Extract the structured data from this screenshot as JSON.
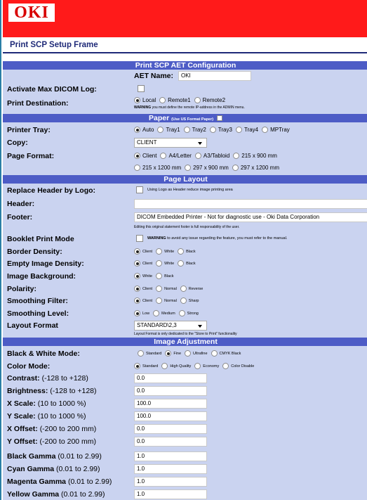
{
  "header": {
    "logo_text": "OKI",
    "page_title": "Print SCP Setup Frame"
  },
  "sections": {
    "aet": "Print SCP AET Configuration",
    "paper": "Paper",
    "paper_note": "(Use US Format Paper)",
    "layout": "Page Layout",
    "image": "Image Adjustment"
  },
  "aet_name": {
    "label": "AET Name:",
    "value": "OKI"
  },
  "max_log": {
    "label": "Activate Max DICOM Log:"
  },
  "destination": {
    "label": "Print Destination:",
    "options": [
      "Local",
      "Remote1",
      "Remote2"
    ],
    "warning_bold": "WARNING",
    "warning": "you must define the remote IP-address in the ADMIN menu."
  },
  "tray": {
    "label": "Printer Tray:",
    "options": [
      "Auto",
      "Tray1",
      "Tray2",
      "Tray3",
      "Tray4",
      "MPTray"
    ]
  },
  "copy": {
    "label": "Copy:",
    "value": "CLIENT"
  },
  "page_format": {
    "label": "Page Format:",
    "options": [
      "Client",
      "A4/Letter",
      "A3/Tabloid",
      "215 x 900 mm",
      "215 x 1200 mm",
      "297 x 900 mm",
      "297 x 1200 mm"
    ]
  },
  "header_logo": {
    "label": "Replace Header by Logo:",
    "note": "Using Logo as Header reduce image printing area"
  },
  "header_field": {
    "label": "Header:",
    "value": ""
  },
  "footer_field": {
    "label": "Footer:",
    "value": "DICOM Embedded Printer  -  Not for diagnostic use  -  Oki Data Corporation",
    "note": "Editing this original statement footer is full responsability of the user."
  },
  "booklet": {
    "label": "Booklet Print Mode",
    "note_bold": "WARNING",
    "note": "to avoid any issue regarding the feature, you must refer to the manual."
  },
  "border_density": {
    "label": "Border Density:",
    "options": [
      "Client",
      "White",
      "Black"
    ]
  },
  "empty_density": {
    "label": "Empty Image Density:",
    "options": [
      "Client",
      "White",
      "Black"
    ]
  },
  "image_bg": {
    "label": "Image Background:",
    "options": [
      "White",
      "Black"
    ]
  },
  "polarity": {
    "label": "Polarity:",
    "options": [
      "Client",
      "Normal",
      "Reverse"
    ]
  },
  "smoothing_filter": {
    "label": "Smoothing Filter:",
    "options": [
      "Client",
      "Normal",
      "Sharp"
    ]
  },
  "smoothing_level": {
    "label": "Smoothing Level:",
    "options": [
      "Low",
      "Medium",
      "Strong"
    ]
  },
  "layout_format": {
    "label": "Layout Format",
    "value": "STANDARD\\2,3",
    "note": "Layout Format is only dedicated to the \"Store to Print\" functionality"
  },
  "bw_mode": {
    "label": "Black & White Mode:",
    "options": [
      "Standard",
      "Fine",
      "Ultrafine",
      "CMYK Black"
    ]
  },
  "color_mode": {
    "label": "Color Mode:",
    "options": [
      "Standard",
      "High Quality",
      "Economy",
      "Color Disable"
    ]
  },
  "fields": [
    {
      "label": "Contrast:",
      "range": "(-128 to +128)",
      "value": "0.0"
    },
    {
      "label": "Brightness:",
      "range": "(-128 to +128)",
      "value": "0.0"
    },
    {
      "label": "X Scale:",
      "range": "(10 to 1000 %)",
      "value": "100.0"
    },
    {
      "label": "Y Scale:",
      "range": "(10 to 1000 %)",
      "value": "100.0"
    },
    {
      "label": "X Offset:",
      "range": "(-200 to 200 mm)",
      "value": "0.0"
    },
    {
      "label": "Y Offset:",
      "range": "(-200 to 200 mm)",
      "value": "0.0"
    },
    {
      "label": "Black Gamma",
      "range": "(0.01 to 2.99)",
      "value": "1.0"
    },
    {
      "label": "Cyan Gamma",
      "range": "(0.01 to 2.99)",
      "value": "1.0"
    },
    {
      "label": "Magenta Gamma",
      "range": "(0.01 to 2.99)",
      "value": "1.0"
    },
    {
      "label": "Yellow Gamma",
      "range": "(0.01 to 2.99)",
      "value": "1.0"
    }
  ],
  "colors": {
    "brand_red": "#ff1a1a",
    "section_blue": "#4d5cc6",
    "panel_bg": "#cad3f0",
    "title_navy": "#1f2a78"
  }
}
